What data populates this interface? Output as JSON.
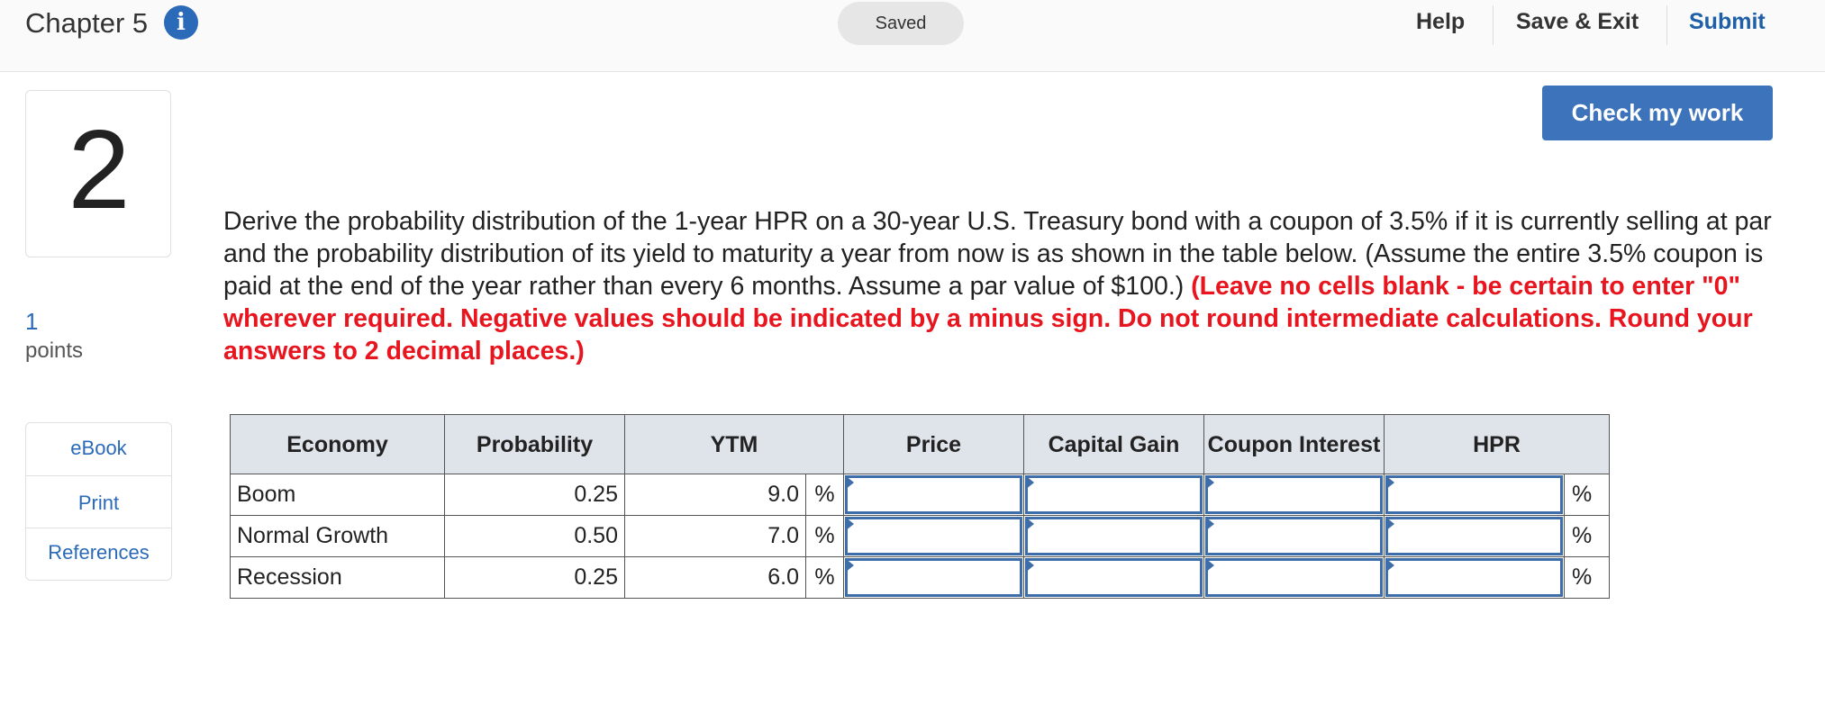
{
  "header": {
    "chapter_title": "Chapter 5",
    "info_glyph": "i",
    "saved_label": "Saved",
    "help_label": "Help",
    "save_exit_label": "Save & Exit",
    "submit_label": "Submit"
  },
  "question": {
    "number": "2",
    "points_value": "1",
    "points_label": "points",
    "text_main": "Derive the probability distribution of the 1-year HPR on a 30-year U.S. Treasury bond with a coupon of 3.5% if it is currently selling at par and the probability distribution of its yield to maturity a year from now is as shown in the table below. (Assume the entire 3.5% coupon is paid at the end of the year rather than every 6 months. Assume a par value of $100.) ",
    "text_instruction": "(Leave no cells blank - be certain to enter \"0\" wherever required. Negative values should be indicated by a minus sign. Do not round intermediate calculations. Round your answers to 2 decimal places.)"
  },
  "sidebar": {
    "links": [
      "eBook",
      "Print",
      "References"
    ]
  },
  "check_button_label": "Check my work",
  "table": {
    "headers": [
      "Economy",
      "Probability",
      "YTM",
      "Price",
      "Capital Gain",
      "Coupon Interest",
      "HPR"
    ],
    "rows": [
      {
        "economy": "Boom",
        "probability": "0.25",
        "ytm": "9.0",
        "ytm_unit": "%",
        "hpr_unit": "%"
      },
      {
        "economy": "Normal Growth",
        "probability": "0.50",
        "ytm": "7.0",
        "ytm_unit": "%",
        "hpr_unit": "%"
      },
      {
        "economy": "Recession",
        "probability": "0.25",
        "ytm": "6.0",
        "ytm_unit": "%",
        "hpr_unit": "%"
      }
    ]
  },
  "colors": {
    "accent_blue": "#3d73bb",
    "instruction_red": "#e8141e",
    "header_bg": "#dfe3ea"
  }
}
